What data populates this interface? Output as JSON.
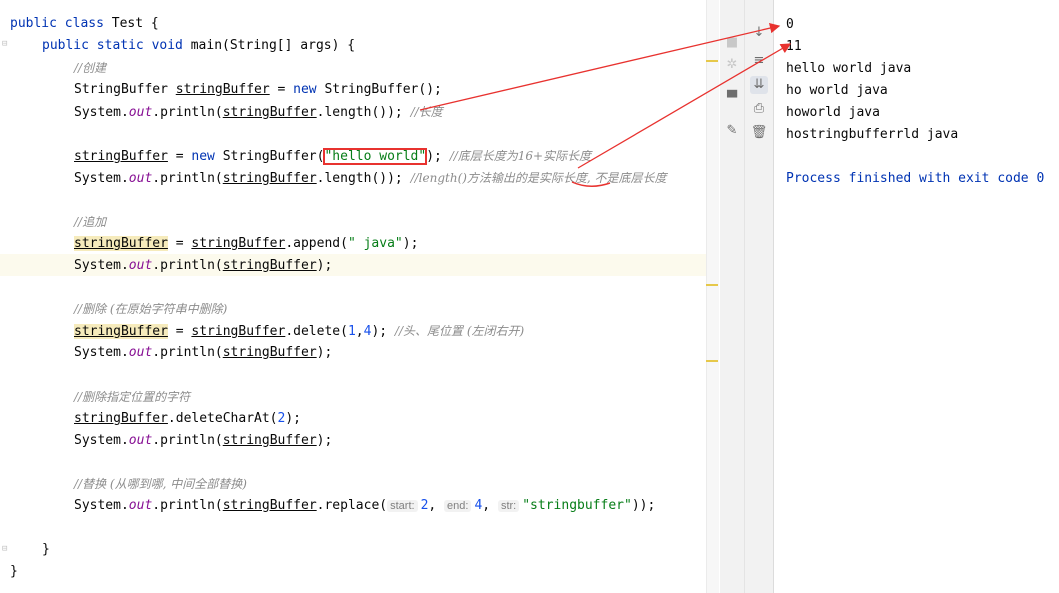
{
  "editor": {
    "lines": {
      "l1_a": "public class ",
      "l1_b": "Test {",
      "l2_a": "public static void ",
      "l2_b": "main(String[] args) {",
      "l3": "//创建",
      "l4_a": "StringBuffer ",
      "l4_b": "stringBuffer",
      "l4_c": " = ",
      "l4_d": "new ",
      "l4_e": "StringBuffer();",
      "l5_a": "System.",
      "l5_b": "out",
      "l5_c": ".println(",
      "l5_d": "stringBuffer",
      "l5_e": ".length()); ",
      "l5_f": "//长度",
      "l7_a": "stringBuffer",
      "l7_b": " = ",
      "l7_c": "new ",
      "l7_d": "StringBuffer(",
      "l7_e": "\"hello world\"",
      "l7_f": "); ",
      "l7_g": "//底层长度为16+实际长度",
      "l8_a": "System.",
      "l8_b": "out",
      "l8_c": ".println(",
      "l8_d": "stringBuffer",
      "l8_e": ".length()); ",
      "l8_f": "//length()方法输出的是实际长度, 不是底层长度",
      "l10": "//追加",
      "l11_a": "stringBuffer",
      "l11_b": " = ",
      "l11_c": "stringBuffer",
      "l11_d": ".append(",
      "l11_e": "\" java\"",
      "l11_f": ");",
      "l12_a": "System.",
      "l12_b": "out",
      "l12_c": ".println(",
      "l12_d": "stringBuffer",
      "l12_e": ");",
      "l14": "//删除 (在原始字符串中删除)",
      "l15_a": "stringBuffer",
      "l15_b": " = ",
      "l15_c": "stringBuffer",
      "l15_d": ".delete(",
      "l15_e": "1",
      "l15_f": ",",
      "l15_g": "4",
      "l15_h": "); ",
      "l15_i": "//头、尾位置 (左闭右开)",
      "l16_a": "System.",
      "l16_b": "out",
      "l16_c": ".println(",
      "l16_d": "stringBuffer",
      "l16_e": ");",
      "l18": "//删除指定位置的字符",
      "l19_a": "stringBuffer",
      "l19_b": ".deleteCharAt(",
      "l19_c": "2",
      "l19_d": ");",
      "l20_a": "System.",
      "l20_b": "out",
      "l20_c": ".println(",
      "l20_d": "stringBuffer",
      "l20_e": ");",
      "l22": "//替换 (从哪到哪, 中间全部替换)",
      "l23_a": "System.",
      "l23_b": "out",
      "l23_c": ".println(",
      "l23_d": "stringBuffer",
      "l23_e": ".replace(",
      "l23_h1": "start:",
      "l23_v1": "2",
      "l23_s1": ", ",
      "l23_h2": "end:",
      "l23_v2": "4",
      "l23_s2": ", ",
      "l23_h3": "str:",
      "l23_v3": "\"stringbuffer\"",
      "l23_end": "));",
      "l25": "}",
      "l26": "}"
    }
  },
  "console": {
    "output": [
      "0",
      "11",
      "hello world java",
      "ho world java",
      "howorld java",
      "hostringbufferrld java"
    ],
    "finish": "Process finished with exit code 0"
  },
  "toolbar": {
    "icons": [
      "scroll-down-icon",
      "wrap-icon",
      "scroll-to-end-icon",
      "print-icon",
      "trash-icon",
      "layout-icon",
      "pin-icon",
      "settings-icon"
    ]
  },
  "colors": {
    "annotation_red": "#e8322f",
    "keyword": "#0033b3",
    "string": "#067d17",
    "number": "#1750eb"
  }
}
